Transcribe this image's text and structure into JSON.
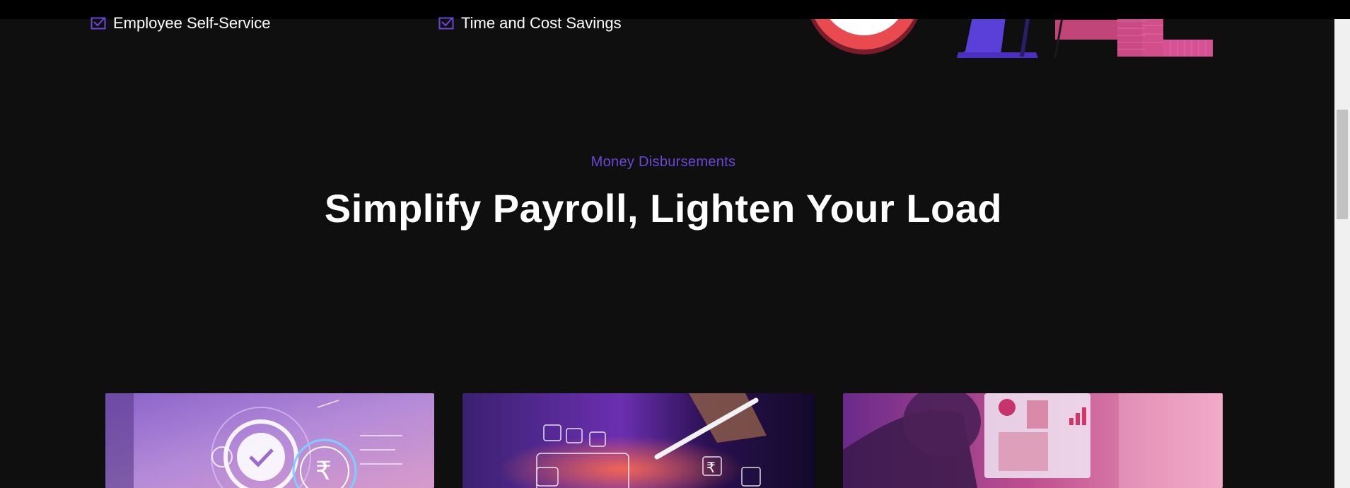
{
  "features": [
    {
      "label": "Employee Self-Service",
      "icon": "check-envelope-icon"
    },
    {
      "label": "Time and Cost Savings",
      "icon": "check-envelope-icon"
    }
  ],
  "section": {
    "eyebrow": "Money Disbursements",
    "title": "Simplify Payroll, Lighten Your Load"
  },
  "cards": [
    {
      "image": "payroll-settings-illustration"
    },
    {
      "image": "digital-finance-stylus-illustration"
    },
    {
      "image": "analytics-laptop-illustration"
    }
  ],
  "colors": {
    "background": "#0f0f0f",
    "accent": "#6c47d6",
    "heading": "#ffffff",
    "pink": "#e0497a"
  }
}
